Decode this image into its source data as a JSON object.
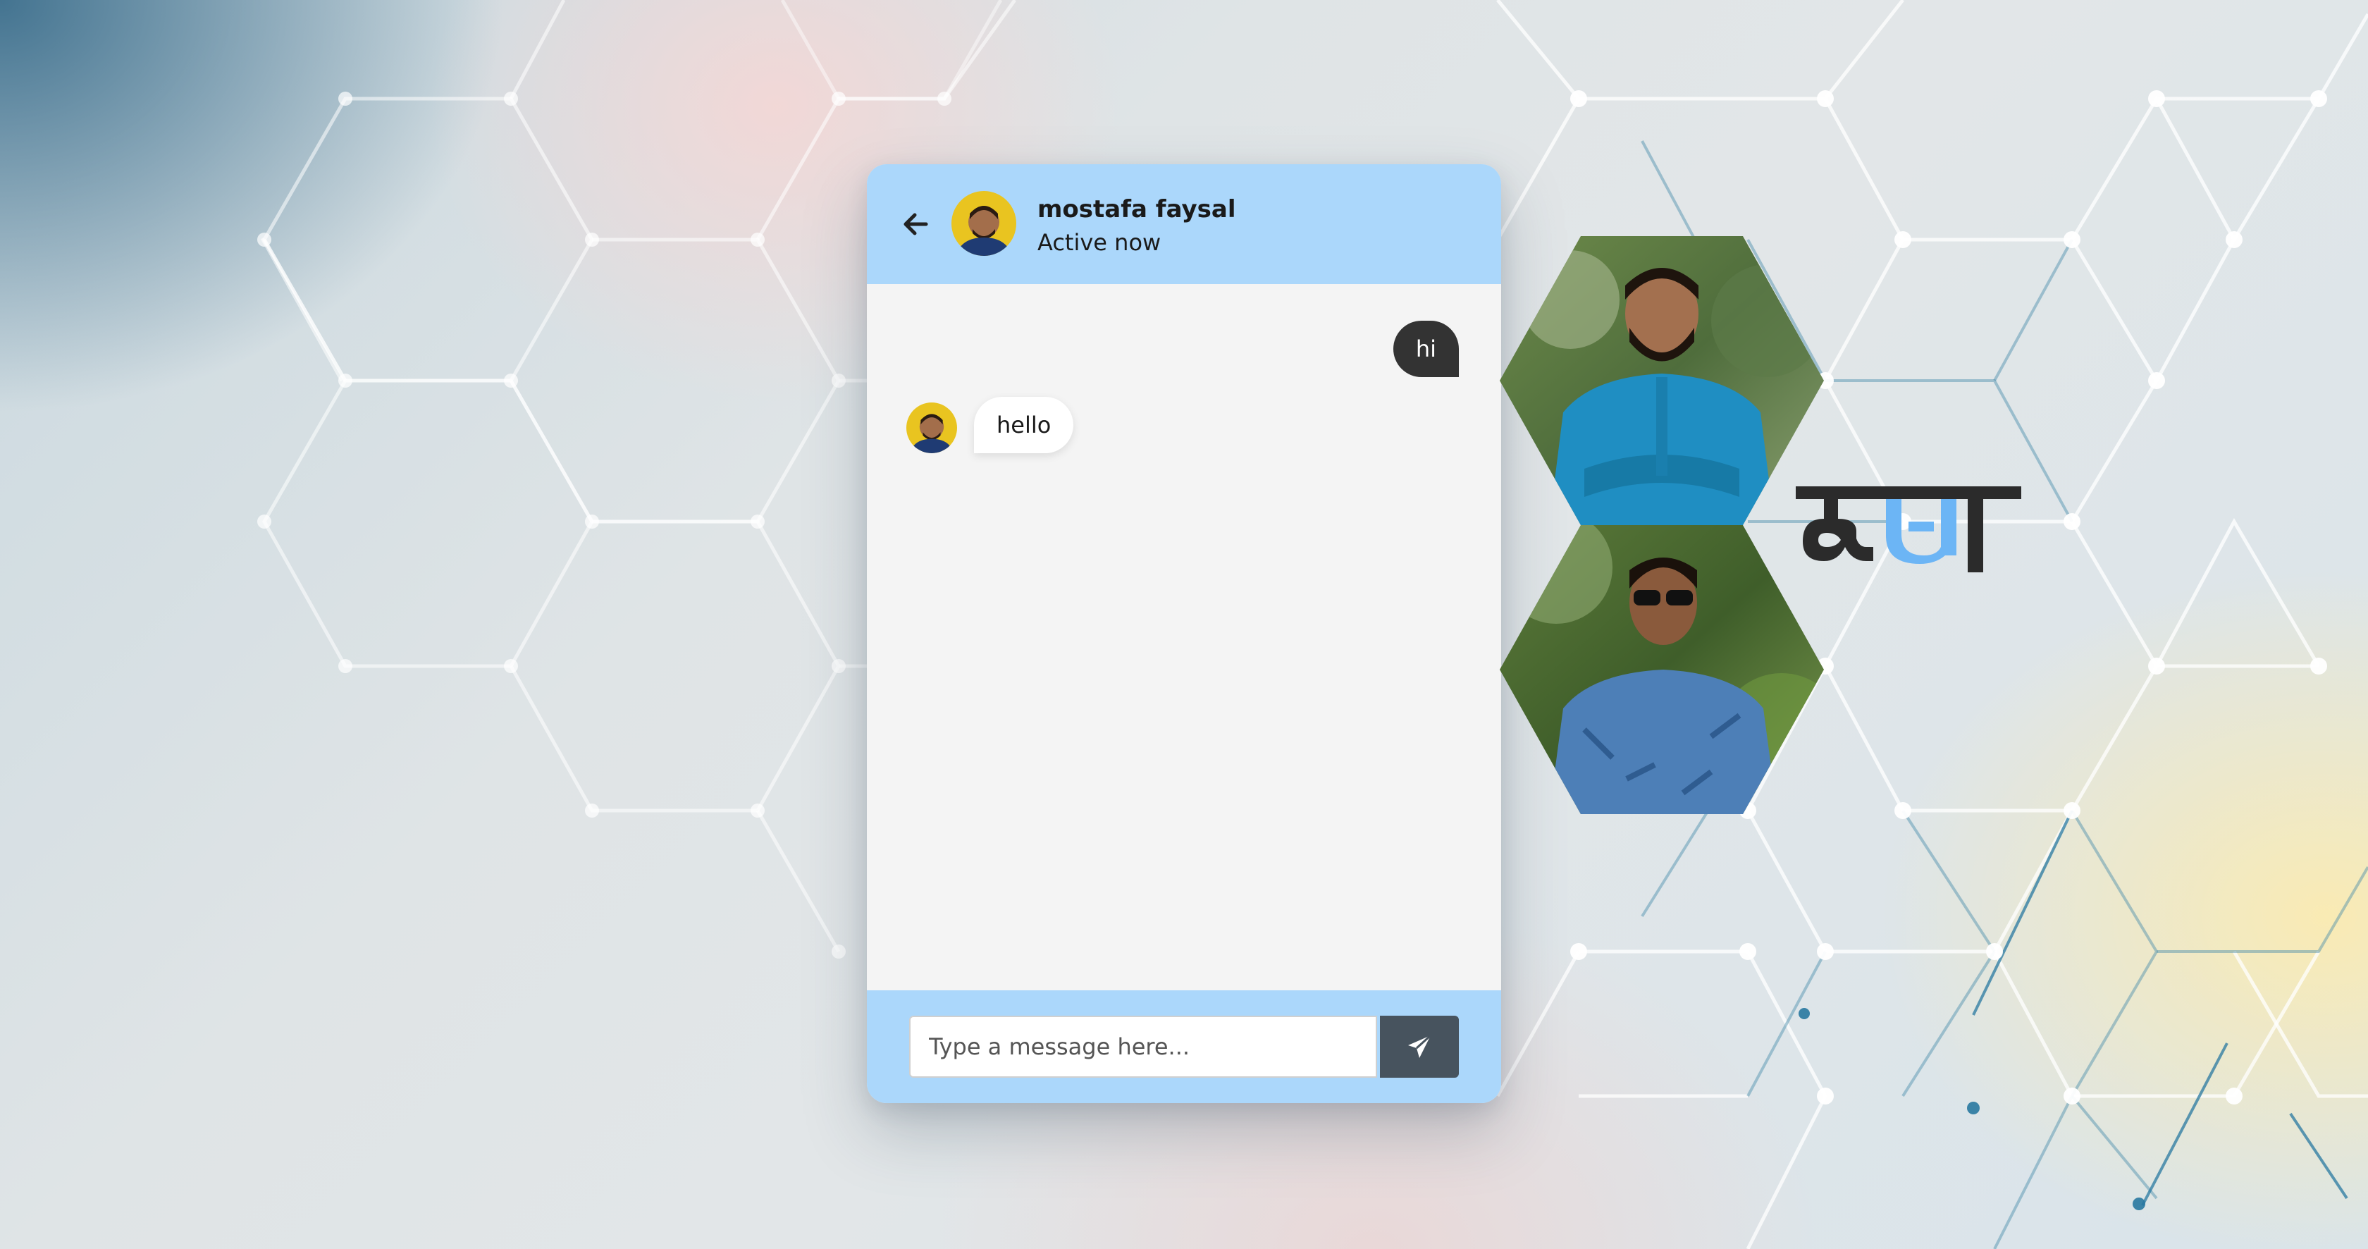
{
  "chat": {
    "contact_name": "mostafa faysal",
    "contact_status": "Active now",
    "messages": [
      {
        "direction": "outgoing",
        "text": "hi"
      },
      {
        "direction": "incoming",
        "text": "hello"
      }
    ],
    "input_placeholder": "Type a message here..."
  },
  "icons": {
    "back": "arrow-left-icon",
    "send": "paper-plane-icon"
  },
  "logo": {
    "text": "কথা",
    "color_dark": "#2b2b2b",
    "color_accent": "#6cb5f5"
  },
  "colors": {
    "header_bg": "#abd7fb",
    "chat_bg": "#f4f4f4",
    "outgoing_bubble": "#333333",
    "incoming_bubble": "#ffffff",
    "send_button": "#47535e"
  }
}
